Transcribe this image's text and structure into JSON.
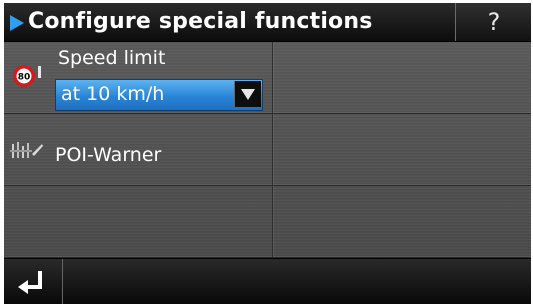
{
  "header": {
    "title": "Configure special functions",
    "help_label": "?"
  },
  "rows": [
    {
      "label": "Speed limit",
      "value": "at 10 km/h",
      "icon": "speed-limit-sign-icon"
    },
    {
      "label": "POI-Warner",
      "icon": "poi-warner-icon"
    },
    {
      "label": ""
    }
  ],
  "speed_sign_text": "80",
  "footer": {
    "back_icon": "back-arrow-icon"
  },
  "colors": {
    "accent": "#2f9ff0",
    "selection": "#2a85d6"
  }
}
